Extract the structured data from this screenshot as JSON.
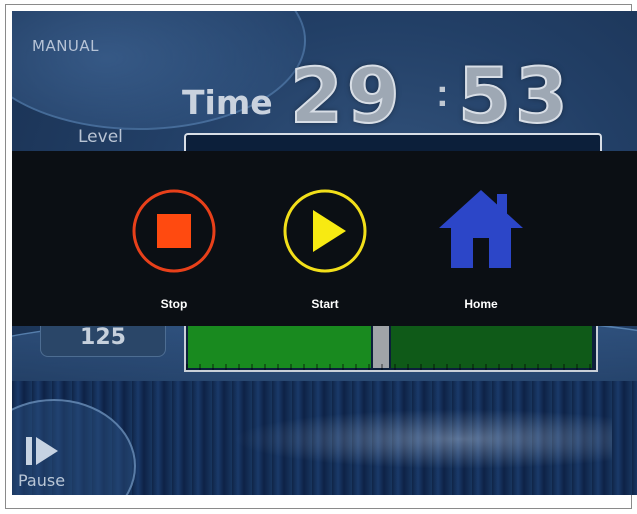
{
  "workout": {
    "mode_label": "MANUAL",
    "time_label": "Time",
    "time_minutes": "29",
    "time_colon": ":",
    "time_seconds": "53",
    "level_label": "Level",
    "speed_value": "125"
  },
  "overlay": {
    "buttons": [
      {
        "label": "Stop",
        "icon": "stop-icon",
        "color": "#e8401a"
      },
      {
        "label": "Start",
        "icon": "play-icon",
        "color": "#f2df1a"
      },
      {
        "label": "Home",
        "icon": "home-icon",
        "color": "#2c46c8"
      }
    ]
  },
  "controls": {
    "pause_label": "Pause"
  },
  "colors": {
    "progress_done": "#198a1f",
    "progress_remaining": "#0f5a18",
    "overlay_background": "#0b0f14"
  }
}
